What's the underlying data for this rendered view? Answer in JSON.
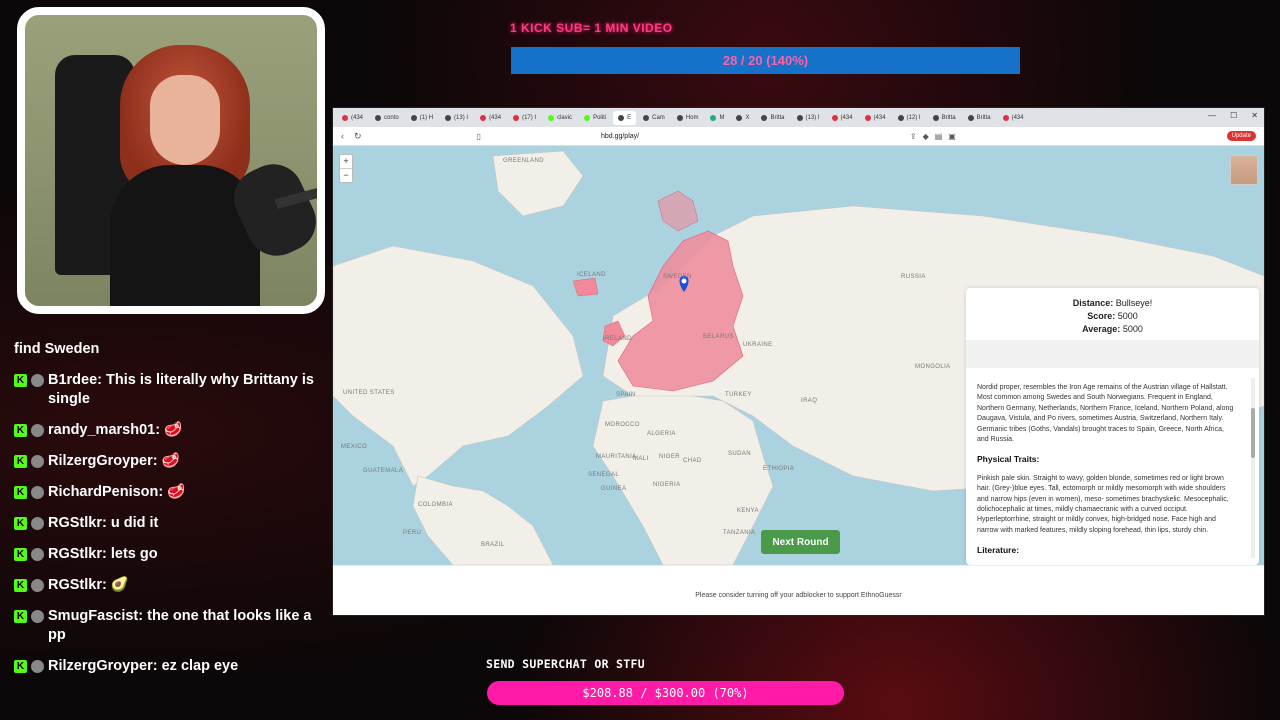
{
  "goal": {
    "label": "1 KICK SUB= 1 MIN VIDEO",
    "progress_text": "28 / 20 (140%)",
    "progress": 1.4
  },
  "browser": {
    "tabs": [
      {
        "label": "(434",
        "color": "#e03040"
      },
      {
        "label": "conto",
        "color": "#444"
      },
      {
        "label": "(1) H",
        "color": "#444"
      },
      {
        "label": "(13) I",
        "color": "#444"
      },
      {
        "label": "(434",
        "color": "#e03040"
      },
      {
        "label": "(17) I",
        "color": "#e03040"
      },
      {
        "label": "clavic",
        "color": "#53fc18"
      },
      {
        "label": "Politi",
        "color": "#53fc18"
      },
      {
        "label": "E",
        "color": "#444"
      },
      {
        "label": "Cam",
        "color": "#444"
      },
      {
        "label": "Hom",
        "color": "#444"
      },
      {
        "label": "M",
        "color": "#2a8"
      },
      {
        "label": "X",
        "color": "#444"
      },
      {
        "label": "Britta",
        "color": "#444"
      },
      {
        "label": "(13) I",
        "color": "#444"
      },
      {
        "label": "(434",
        "color": "#e03040"
      },
      {
        "label": "(434",
        "color": "#e03040"
      },
      {
        "label": "(12) I",
        "color": "#444"
      },
      {
        "label": "Britta",
        "color": "#444"
      },
      {
        "label": "Britta",
        "color": "#444"
      },
      {
        "label": "(434",
        "color": "#e03040"
      }
    ],
    "url": "hbd.gg/play/",
    "update_label": "Update"
  },
  "map": {
    "labels": [
      "GREENLAND",
      "ICELAND",
      "RUSSIA",
      "UNITED STATES",
      "MEXICO",
      "GUATEMALA",
      "COLOMBIA",
      "PERU",
      "BRAZIL",
      "BELARUS",
      "SPAIN",
      "UKRAINE",
      "TURKEY",
      "IRAQ",
      "MONGOLIA",
      "MOROCCO",
      "ALGERIA",
      "MAURITANIA",
      "MALI",
      "NIGER",
      "SENEGAL",
      "GUINEA",
      "CHAD",
      "SUDAN",
      "ETHIOPIA",
      "KENYA",
      "TANZANIA",
      "NIGERIA",
      "IRELAND",
      "SWEDEN"
    ]
  },
  "result": {
    "distance_label": "Distance:",
    "distance_value": "Bullseye!",
    "score_label": "Score:",
    "score_value": "5000",
    "average_label": "Average:",
    "average_value": "5000",
    "description": "Nordid proper, resembles the Iron Age remains of the Austrian village of Hallstatt. Most common among Swedes and South Norwegians. Frequent in England, Northern Germany, Netherlands, Northern France, Iceland, Northern Poland, along Daugava, Vistula, and Po rivers, sometimes Austria, Switzerland, Northern Italy. Germanic tribes (Goths, Vandals) brought traces to Spain, Greece, North Africa, and Russia.",
    "traits_heading": "Physical Traits:",
    "traits": "Pinkish pale skin. Straight to wavy, golden blonde, sometimes red or light brown hair. (Grey-)blue eyes. Tall, ectomorph or mildly mesomorph with wide shoulders and narrow hips (even in women), meso- sometimes brachyskelic. Mesocephalic, dolichocephalic at times, mildly chamaecranic with a curved occiput. Hyperleptorrhine, straight or mildly convex, high-bridged nose. Face high and narrow with marked features, mildly sloping forehead, thin lips, sturdy chin.",
    "literature_heading": "Literature:"
  },
  "next_round_label": "Next Round",
  "footer_text": "Please consider turning off your adblocker to support EthnoGuessr",
  "chat": [
    {
      "user": "",
      "text": "find Sweden"
    },
    {
      "user": "B1rdee",
      "text": "This is literally why Brittany is single"
    },
    {
      "user": "randy_marsh01",
      "text": "🥩"
    },
    {
      "user": "RilzergGroyper",
      "text": "🥩"
    },
    {
      "user": "RichardPenison",
      "text": "🥩"
    },
    {
      "user": "RGStlkr",
      "text": "u did it"
    },
    {
      "user": "RGStlkr",
      "text": "lets go"
    },
    {
      "user": "RGStlkr",
      "text": "🥑"
    },
    {
      "user": "SmugFascist",
      "text": "the one that looks like a pp"
    },
    {
      "user": "RilzergGroyper",
      "text": "ez clap eye"
    }
  ],
  "superchat": {
    "label": "SEND SUPERCHAT OR STFU",
    "progress_text": "$208.88 / $300.00 (70%)",
    "progress": 0.7
  },
  "colors": {
    "kick_green": "#53fc18",
    "superchat_pink": "#ff1aa8",
    "goal_blue": "#1672c8",
    "next_green": "#4a9a4a"
  }
}
